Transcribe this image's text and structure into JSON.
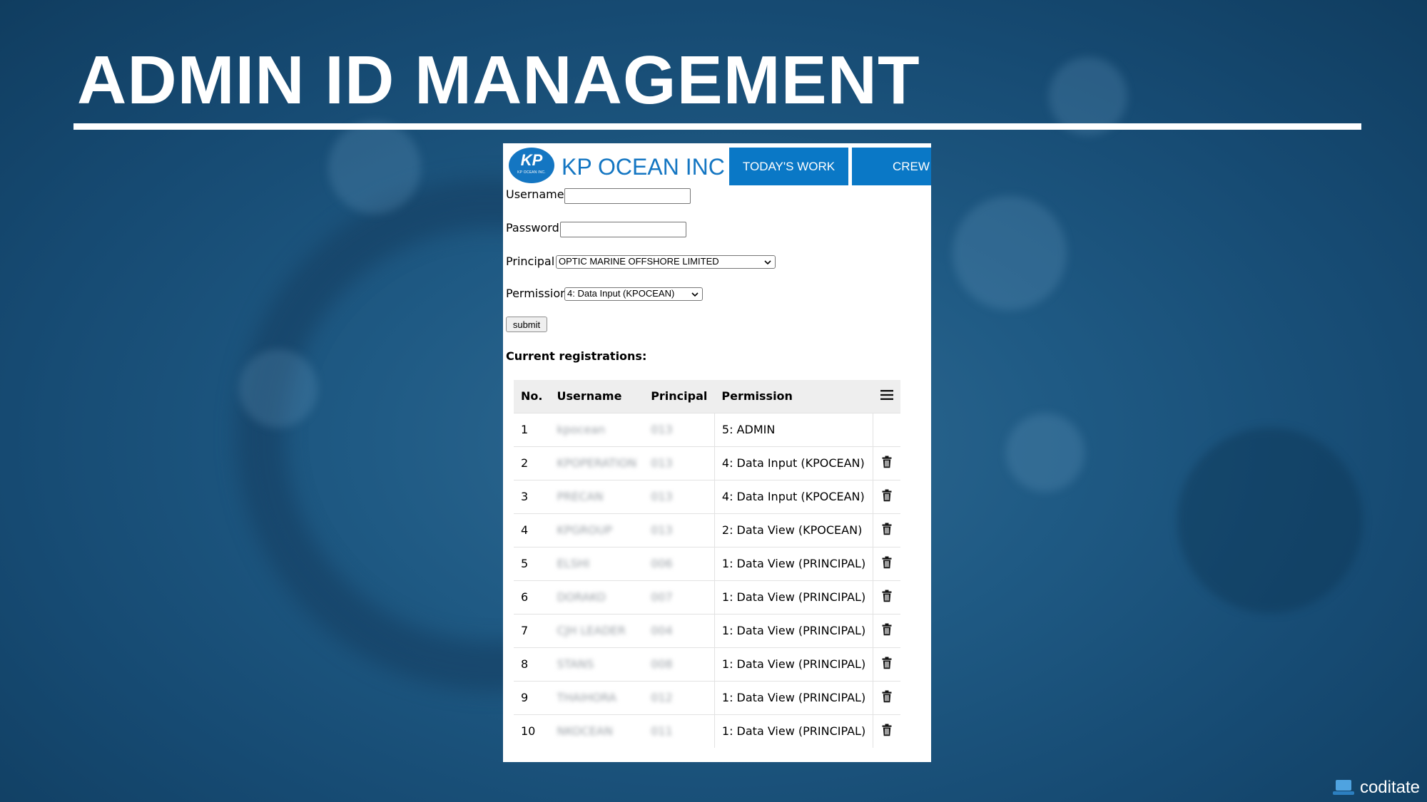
{
  "slide": {
    "title": "ADMIN ID MANAGEMENT",
    "watermark": "coditate"
  },
  "app": {
    "logo_text": "KP",
    "logo_subtext": "KP OCEAN INC.",
    "brand_name": "KP OCEAN INC",
    "nav_tabs": [
      {
        "label": "TODAY'S WORK"
      },
      {
        "label": "CREW"
      }
    ],
    "accent_color": "#0a78c6"
  },
  "form": {
    "username_label": "Username",
    "username_value": "",
    "password_label": "Password",
    "password_value": "",
    "principal_label": "Principal",
    "principal_selected": "OPTIC MARINE OFFSHORE LIMITED",
    "permission_label": "Permission",
    "permission_selected": "4: Data Input (KPOCEAN)",
    "submit_label": "submit"
  },
  "registrations": {
    "heading": "Current registrations:",
    "columns": [
      "No.",
      "Username",
      "Principal",
      "Permission"
    ],
    "rows": [
      {
        "no": "1",
        "username": "kpocean",
        "principal": "013",
        "permission": "5: ADMIN",
        "deletable": false
      },
      {
        "no": "2",
        "username": "KPOPERATION",
        "principal": "013",
        "permission": "4: Data Input (KPOCEAN)",
        "deletable": true
      },
      {
        "no": "3",
        "username": "PRECAN",
        "principal": "013",
        "permission": "4: Data Input (KPOCEAN)",
        "deletable": true
      },
      {
        "no": "4",
        "username": "KPGROUP",
        "principal": "013",
        "permission": "2: Data View (KPOCEAN)",
        "deletable": true
      },
      {
        "no": "5",
        "username": "ELSHI",
        "principal": "006",
        "permission": "1: Data View (PRINCIPAL)",
        "deletable": true
      },
      {
        "no": "6",
        "username": "DORAKO",
        "principal": "007",
        "permission": "1: Data View (PRINCIPAL)",
        "deletable": true
      },
      {
        "no": "7",
        "username": "CJH LEADER",
        "principal": "004",
        "permission": "1: Data View (PRINCIPAL)",
        "deletable": true
      },
      {
        "no": "8",
        "username": "STANS",
        "principal": "008",
        "permission": "1: Data View (PRINCIPAL)",
        "deletable": true
      },
      {
        "no": "9",
        "username": "THAIHORA",
        "principal": "012",
        "permission": "1: Data View (PRINCIPAL)",
        "deletable": true
      },
      {
        "no": "10",
        "username": "NKOCEAN",
        "principal": "011",
        "permission": "1: Data View (PRINCIPAL)",
        "deletable": true
      }
    ]
  }
}
